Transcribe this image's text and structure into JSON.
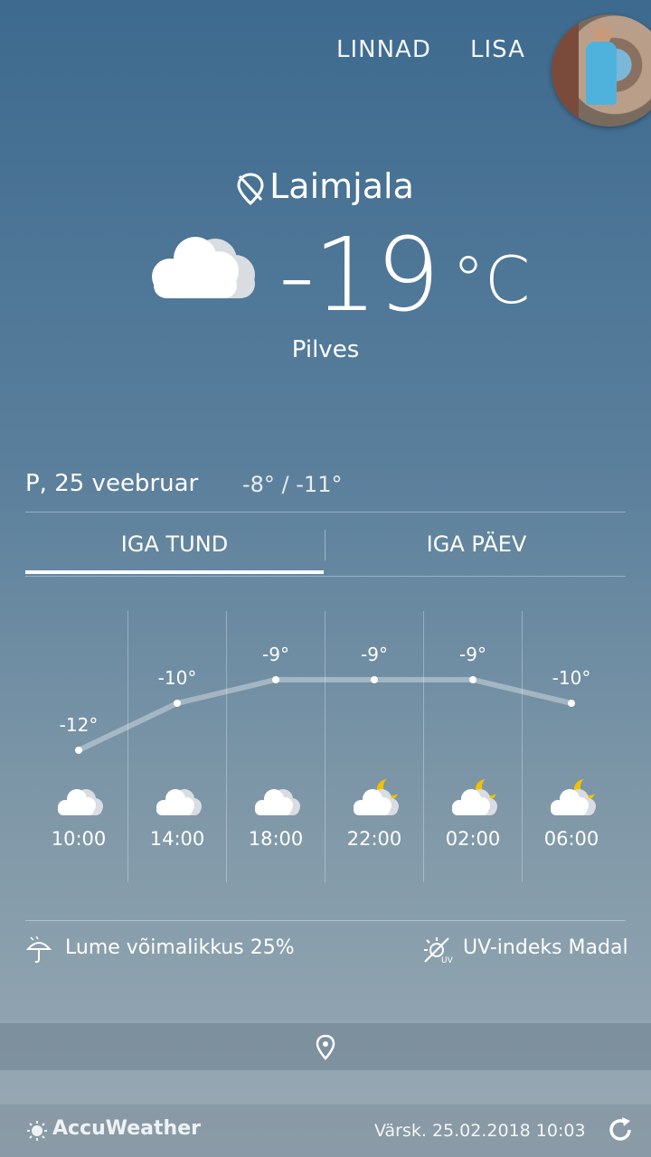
{
  "header": {
    "cities_label": "LINNAD",
    "add_label": "LISA"
  },
  "current": {
    "city": "Laimjala",
    "temperature": "-19",
    "unit": "°C",
    "condition": "Pilves"
  },
  "today": {
    "date": "P, 25 veebruar",
    "high_low": "-8° / -11°"
  },
  "tabs": [
    {
      "label": "IGA TUND",
      "active": true
    },
    {
      "label": "IGA PÄEV",
      "active": false
    }
  ],
  "hourly": [
    {
      "time": "10:00",
      "temp_label": "-12°",
      "temp": -12,
      "icon": "cloudy-icon"
    },
    {
      "time": "14:00",
      "temp_label": "-10°",
      "temp": -10,
      "icon": "cloudy-icon"
    },
    {
      "time": "18:00",
      "temp_label": "-9°",
      "temp": -9,
      "icon": "cloudy-icon"
    },
    {
      "time": "22:00",
      "temp_label": "-9°",
      "temp": -9,
      "icon": "cloudy-night-icon"
    },
    {
      "time": "02:00",
      "temp_label": "-9°",
      "temp": -9,
      "icon": "cloudy-night-icon"
    },
    {
      "time": "06:00",
      "temp_label": "-10°",
      "temp": -10,
      "icon": "cloudy-night-icon"
    }
  ],
  "details": {
    "snow": "Lume võimalikkus 25%",
    "uv": "UV-indeks Madal"
  },
  "footer": {
    "brand": "AccuWeather",
    "updated": "Värsk. 25.02.2018 10:03"
  },
  "colors": {
    "moon": "#f2c200",
    "cloud": "#ffffff"
  }
}
